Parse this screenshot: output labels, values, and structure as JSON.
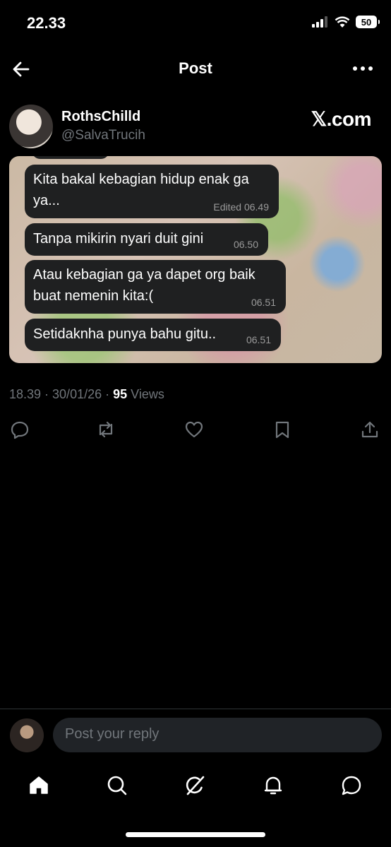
{
  "status_bar": {
    "time": "22.33",
    "battery": "50"
  },
  "header": {
    "title": "Post"
  },
  "author": {
    "name": "RothsChilld",
    "handle": "@SalvaTrucih",
    "brand": "𝕏.com"
  },
  "messages": [
    {
      "line1": "Kita bakal kebagian hidup enak ga",
      "line2": "ya...",
      "time": "Edited 06.49"
    },
    {
      "line1": "Tanpa mikirin nyari duit gini",
      "line2": "",
      "time": "06.50"
    },
    {
      "line1": "Atau kebagian ga ya dapet org baik",
      "line2": "buat nemenin kita:(",
      "time": "06.51"
    },
    {
      "line1": "Setidaknha punya bahu gitu..",
      "line2": "",
      "time": "06.51"
    }
  ],
  "meta": {
    "prefix": "18.39 · 30/01/26 · ",
    "views_count": "95",
    "views_label": " Views"
  },
  "actions": [
    "reply-icon",
    "repost-icon",
    "like-icon",
    "bookmark-icon",
    "share-icon"
  ],
  "reply": {
    "placeholder": "Post your reply"
  },
  "tabs": [
    "home-icon",
    "search-icon",
    "grok-icon",
    "notifications-icon",
    "messages-icon"
  ],
  "colors": {
    "background": "#000000",
    "muted": "#71767b",
    "bubble": "#1f2021"
  }
}
